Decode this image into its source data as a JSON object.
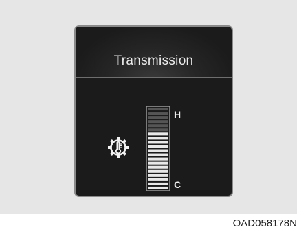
{
  "panel": {
    "title": "Transmission",
    "icon": "transmission-temperature-icon"
  },
  "gauge": {
    "high_label": "H",
    "low_label": "C",
    "total_segments": 20,
    "lit_segments": 14
  },
  "figure_code": "OAD058178N",
  "colors": {
    "backdrop": "#e6e6e6",
    "panel": "#1b1b1b",
    "lit_segment": "#e8e8e8",
    "unlit_segment": "#555555"
  }
}
